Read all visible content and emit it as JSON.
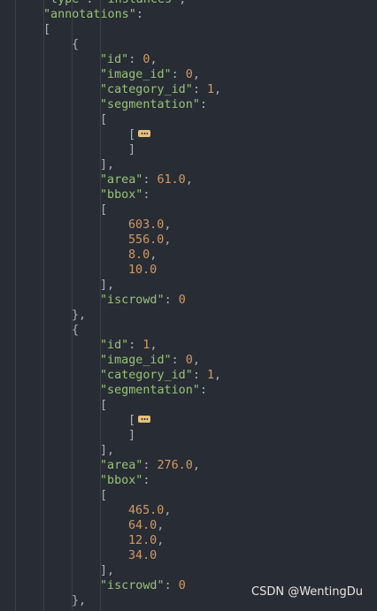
{
  "editor": {
    "lines": [
      {
        "indent": 0,
        "parts": [
          {
            "t": "str",
            "v": "\"type\""
          },
          {
            "t": "pun",
            "v": ": "
          },
          {
            "t": "str",
            "v": "\"instances\""
          },
          {
            "t": "pun",
            "v": ","
          }
        ]
      },
      {
        "indent": 0,
        "parts": [
          {
            "t": "str",
            "v": "\"annotations\""
          },
          {
            "t": "pun",
            "v": ":"
          }
        ]
      },
      {
        "indent": 0,
        "parts": [
          {
            "t": "pun",
            "v": "["
          }
        ]
      },
      {
        "indent": 1,
        "parts": [
          {
            "t": "pun",
            "v": "{"
          }
        ]
      },
      {
        "indent": 2,
        "parts": [
          {
            "t": "str",
            "v": "\"id\""
          },
          {
            "t": "pun",
            "v": ": "
          },
          {
            "t": "num",
            "v": "0"
          },
          {
            "t": "pun",
            "v": ","
          }
        ]
      },
      {
        "indent": 2,
        "parts": [
          {
            "t": "str",
            "v": "\"image_id\""
          },
          {
            "t": "pun",
            "v": ": "
          },
          {
            "t": "num",
            "v": "0"
          },
          {
            "t": "pun",
            "v": ","
          }
        ]
      },
      {
        "indent": 2,
        "parts": [
          {
            "t": "str",
            "v": "\"category_id\""
          },
          {
            "t": "pun",
            "v": ": "
          },
          {
            "t": "num",
            "v": "1"
          },
          {
            "t": "pun",
            "v": ","
          }
        ]
      },
      {
        "indent": 2,
        "parts": [
          {
            "t": "str",
            "v": "\"segmentation\""
          },
          {
            "t": "pun",
            "v": ":"
          }
        ]
      },
      {
        "indent": 2,
        "parts": [
          {
            "t": "pun",
            "v": "["
          }
        ]
      },
      {
        "indent": 3,
        "parts": [
          {
            "t": "pun",
            "v": "["
          },
          {
            "t": "fold",
            "v": ""
          }
        ]
      },
      {
        "indent": 3,
        "parts": [
          {
            "t": "pun",
            "v": "]"
          }
        ]
      },
      {
        "indent": 2,
        "parts": [
          {
            "t": "pun",
            "v": "],"
          }
        ]
      },
      {
        "indent": 2,
        "parts": [
          {
            "t": "str",
            "v": "\"area\""
          },
          {
            "t": "pun",
            "v": ": "
          },
          {
            "t": "num",
            "v": "61.0"
          },
          {
            "t": "pun",
            "v": ","
          }
        ]
      },
      {
        "indent": 2,
        "parts": [
          {
            "t": "str",
            "v": "\"bbox\""
          },
          {
            "t": "pun",
            "v": ":"
          }
        ]
      },
      {
        "indent": 2,
        "parts": [
          {
            "t": "pun",
            "v": "["
          }
        ]
      },
      {
        "indent": 3,
        "parts": [
          {
            "t": "num",
            "v": "603.0"
          },
          {
            "t": "pun",
            "v": ","
          }
        ]
      },
      {
        "indent": 3,
        "parts": [
          {
            "t": "num",
            "v": "556.0"
          },
          {
            "t": "pun",
            "v": ","
          }
        ]
      },
      {
        "indent": 3,
        "parts": [
          {
            "t": "num",
            "v": "8.0"
          },
          {
            "t": "pun",
            "v": ","
          }
        ]
      },
      {
        "indent": 3,
        "parts": [
          {
            "t": "num",
            "v": "10.0"
          }
        ]
      },
      {
        "indent": 2,
        "parts": [
          {
            "t": "pun",
            "v": "],"
          }
        ]
      },
      {
        "indent": 2,
        "parts": [
          {
            "t": "str",
            "v": "\"iscrowd\""
          },
          {
            "t": "pun",
            "v": ": "
          },
          {
            "t": "num",
            "v": "0"
          }
        ]
      },
      {
        "indent": 1,
        "parts": [
          {
            "t": "pun",
            "v": "},"
          }
        ]
      },
      {
        "indent": 1,
        "parts": [
          {
            "t": "pun",
            "v": "{"
          }
        ]
      },
      {
        "indent": 2,
        "parts": [
          {
            "t": "str",
            "v": "\"id\""
          },
          {
            "t": "pun",
            "v": ": "
          },
          {
            "t": "num",
            "v": "1"
          },
          {
            "t": "pun",
            "v": ","
          }
        ]
      },
      {
        "indent": 2,
        "parts": [
          {
            "t": "str",
            "v": "\"image_id\""
          },
          {
            "t": "pun",
            "v": ": "
          },
          {
            "t": "num",
            "v": "0"
          },
          {
            "t": "pun",
            "v": ","
          }
        ]
      },
      {
        "indent": 2,
        "parts": [
          {
            "t": "str",
            "v": "\"category_id\""
          },
          {
            "t": "pun",
            "v": ": "
          },
          {
            "t": "num",
            "v": "1"
          },
          {
            "t": "pun",
            "v": ","
          }
        ]
      },
      {
        "indent": 2,
        "parts": [
          {
            "t": "str",
            "v": "\"segmentation\""
          },
          {
            "t": "pun",
            "v": ":"
          }
        ]
      },
      {
        "indent": 2,
        "parts": [
          {
            "t": "pun",
            "v": "["
          }
        ]
      },
      {
        "indent": 3,
        "parts": [
          {
            "t": "pun",
            "v": "["
          },
          {
            "t": "fold",
            "v": ""
          }
        ]
      },
      {
        "indent": 3,
        "parts": [
          {
            "t": "pun",
            "v": "]"
          }
        ]
      },
      {
        "indent": 2,
        "parts": [
          {
            "t": "pun",
            "v": "],"
          }
        ]
      },
      {
        "indent": 2,
        "parts": [
          {
            "t": "str",
            "v": "\"area\""
          },
          {
            "t": "pun",
            "v": ": "
          },
          {
            "t": "num",
            "v": "276.0"
          },
          {
            "t": "pun",
            "v": ","
          }
        ]
      },
      {
        "indent": 2,
        "parts": [
          {
            "t": "str",
            "v": "\"bbox\""
          },
          {
            "t": "pun",
            "v": ":"
          }
        ]
      },
      {
        "indent": 2,
        "parts": [
          {
            "t": "pun",
            "v": "["
          }
        ]
      },
      {
        "indent": 3,
        "parts": [
          {
            "t": "num",
            "v": "465.0"
          },
          {
            "t": "pun",
            "v": ","
          }
        ]
      },
      {
        "indent": 3,
        "parts": [
          {
            "t": "num",
            "v": "64.0"
          },
          {
            "t": "pun",
            "v": ","
          }
        ]
      },
      {
        "indent": 3,
        "parts": [
          {
            "t": "num",
            "v": "12.0"
          },
          {
            "t": "pun",
            "v": ","
          }
        ]
      },
      {
        "indent": 3,
        "parts": [
          {
            "t": "num",
            "v": "34.0"
          }
        ]
      },
      {
        "indent": 2,
        "parts": [
          {
            "t": "pun",
            "v": "],"
          }
        ]
      },
      {
        "indent": 2,
        "parts": [
          {
            "t": "str",
            "v": "\"iscrowd\""
          },
          {
            "t": "pun",
            "v": ": "
          },
          {
            "t": "num",
            "v": "0"
          }
        ]
      },
      {
        "indent": 1,
        "parts": [
          {
            "t": "pun",
            "v": "},"
          }
        ]
      }
    ]
  },
  "colors": {
    "background": "#282c34",
    "string": "#98c379",
    "number": "#d19a66",
    "punctuation": "#abb2bf",
    "fold_badge": "#e5c07b"
  },
  "watermark": "CSDN @WentingDu"
}
